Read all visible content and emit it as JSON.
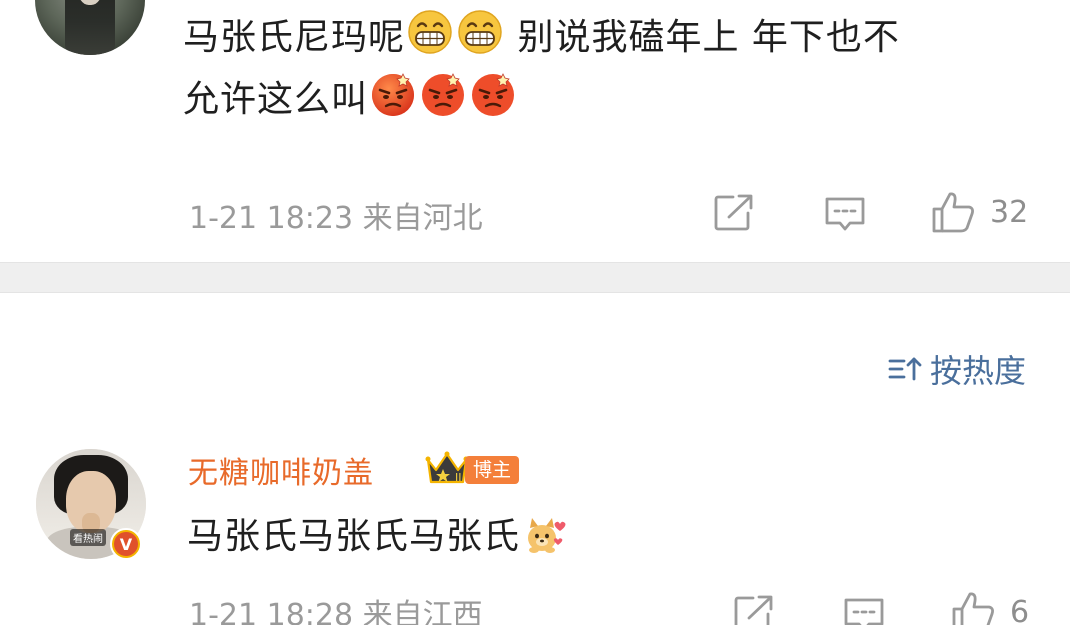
{
  "comment1": {
    "line1_text": "马张氏尼玛呢",
    "line1_text_after": " 别说我磕年上 年下也不",
    "line2_text": "允许这么叫",
    "emoji_grin": "grin-emoji",
    "emoji_angry": "angry-emoji",
    "timestamp": "1-21 18:23",
    "location": "来自河北",
    "like_count": "32"
  },
  "sort": {
    "label": "按热度",
    "icon": "sort-icon"
  },
  "comment2": {
    "username": "无糖咖啡奶盖",
    "badge_label": "博主",
    "avatar_tag": "看热闹",
    "text": "马张氏马张氏马张氏",
    "timestamp": "1-21 18:28",
    "location": "来自江西",
    "like_count": "6",
    "verified_mark": "V"
  },
  "colors": {
    "username": "#e86a2a",
    "sort_link": "#4a6f9c",
    "meta_gray": "#9a9a9a",
    "separator": "#efefef",
    "badge_bg": "#f47f3a"
  }
}
